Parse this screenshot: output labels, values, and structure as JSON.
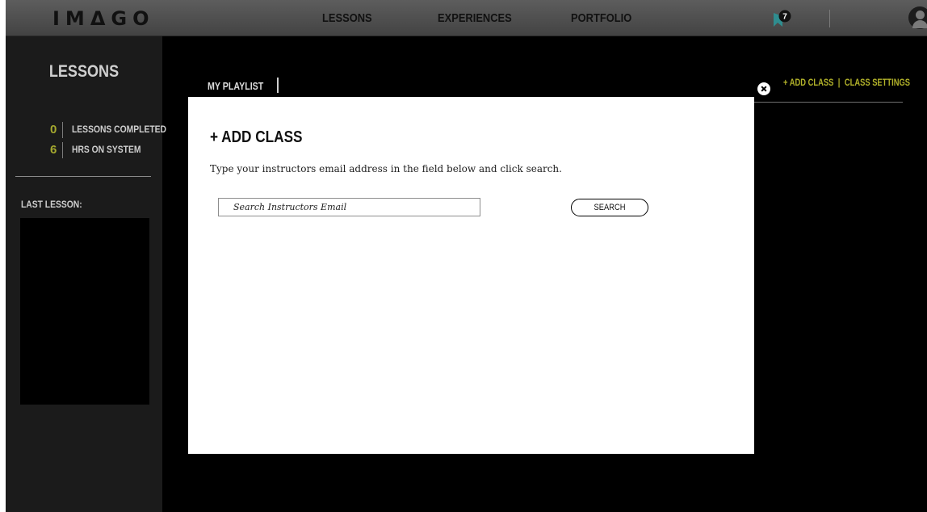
{
  "header": {
    "logo": "IMΔGO",
    "nav": [
      {
        "label": "LESSONS"
      },
      {
        "label": "EXPERIENCES"
      },
      {
        "label": "PORTFOLIO"
      }
    ],
    "notification_count": "7",
    "accent_color": "#2f8d8f"
  },
  "sidebar": {
    "title": "LESSONS",
    "stats": [
      {
        "value": "0",
        "label": "LESSONS COMPLETED"
      },
      {
        "value": "6",
        "label": "HRS ON SYSTEM"
      }
    ],
    "last_lesson_label": "LAST LESSON:"
  },
  "main": {
    "playlist_tab": "MY PLAYLIST",
    "add_class_link": "+ ADD CLASS",
    "link_separator": "|",
    "class_settings_link": "CLASS SETTINGS"
  },
  "modal": {
    "title": "+ ADD CLASS",
    "instructions": "Type your instructors email address in the field below and click search.",
    "search_placeholder": "Search Instructors Email",
    "search_value": "",
    "search_button": "SEARCH"
  }
}
